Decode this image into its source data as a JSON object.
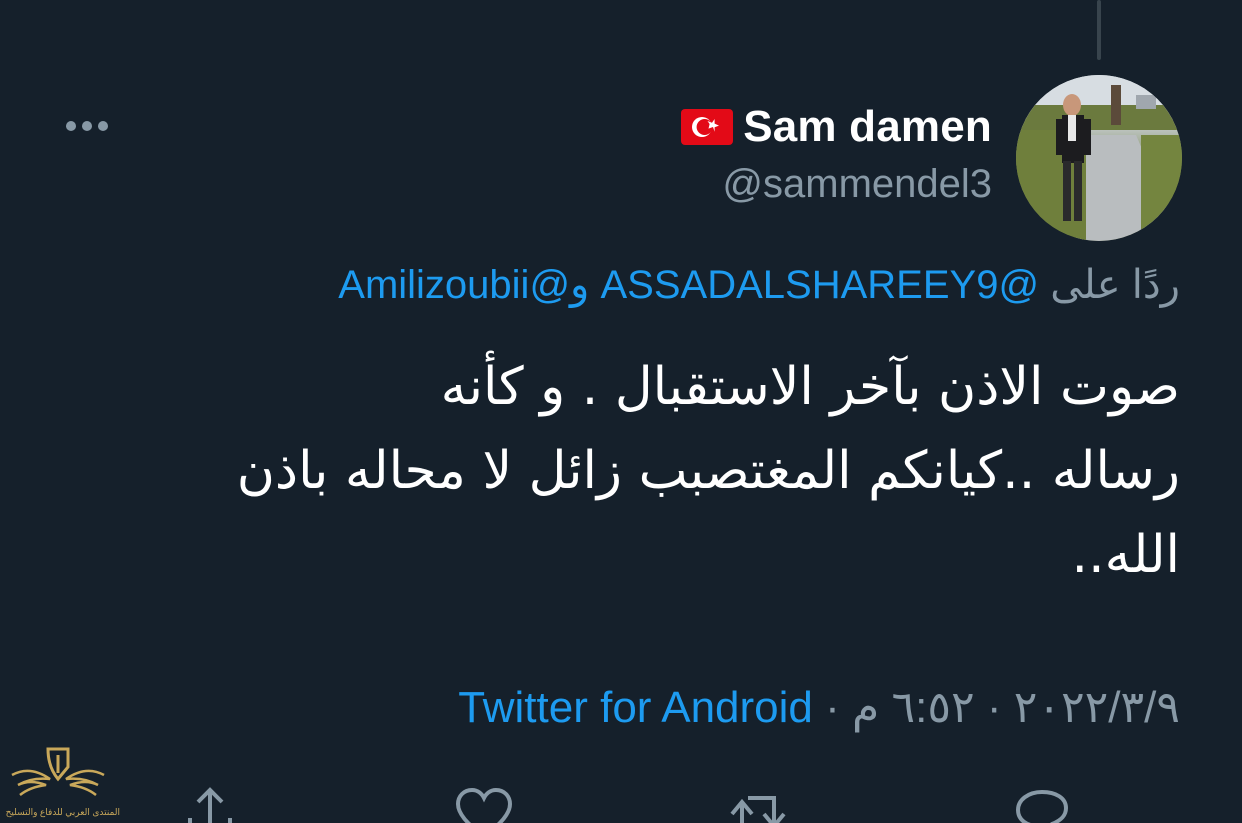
{
  "author": {
    "display_name": "Sam damen",
    "flag_emoji": "flag-turkey-icon",
    "handle": "@sammendel3"
  },
  "reply": {
    "prefix": "ردًا على",
    "mention_1": "@ASSADALSHAREEY9",
    "separator": "و",
    "mention_2": "@Amilizoubii"
  },
  "tweet": {
    "lines": [
      "صوت الاذن بآخر الاستقبال . و كأنه",
      "رساله ..كيانكم المغتصبب زائل لا محاله باذن",
      "الله.."
    ]
  },
  "meta": {
    "date": "٢٠٢٢/٣/٩",
    "sep1": "·",
    "time": "٦:٥٢ م",
    "sep2": "·",
    "source": "Twitter for Android"
  },
  "actions": [
    "reply-icon",
    "retweet-icon",
    "like-icon",
    "share-icon"
  ],
  "watermark": {
    "text": "المنتدى العربي للدفاع والتسليح"
  },
  "colors": {
    "background": "#15202b",
    "accent": "#1d9bf0",
    "secondary_text": "#8899a6",
    "flag_red": "#e30a17"
  }
}
